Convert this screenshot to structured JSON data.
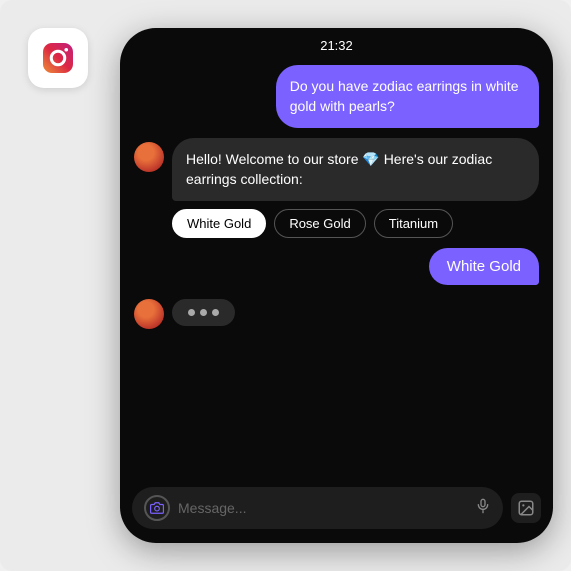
{
  "scene": {
    "background": "#ebebeb"
  },
  "instagram": {
    "label": "Instagram"
  },
  "phone": {
    "status_time": "21:32"
  },
  "chat": {
    "user_message": "Do you have zodiac earrings in white gold with pearls?",
    "bot_message": "Hello! Welcome to our store 💎 Here's our zodiac earrings collection:",
    "options": [
      {
        "label": "White Gold",
        "selected": true
      },
      {
        "label": "Rose Gold",
        "selected": false
      },
      {
        "label": "Titanium",
        "selected": false
      }
    ],
    "user_reply": "White Gold",
    "typing_dots": [
      "•",
      "•",
      "•"
    ]
  },
  "input_bar": {
    "placeholder": "Message...",
    "camera_label": "camera-icon",
    "mic_label": "mic-icon",
    "media_label": "media-icon"
  }
}
